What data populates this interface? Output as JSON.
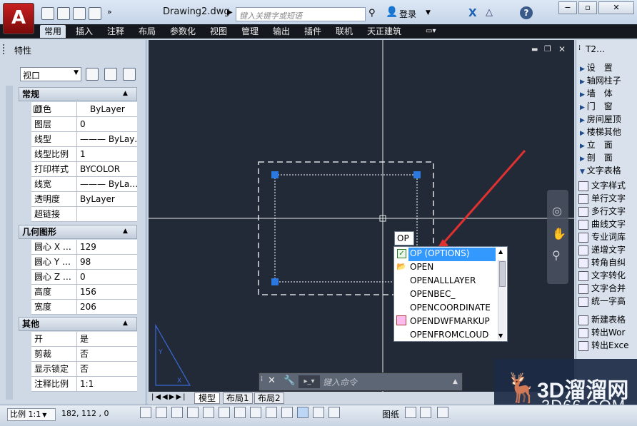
{
  "app": {
    "logo": "A",
    "title": "Drawing2.dwg",
    "search_placeholder": "键入关键字或短语",
    "login": "登录"
  },
  "ribbon_tabs": [
    "常用",
    "插入",
    "注释",
    "布局",
    "参数化",
    "视图",
    "管理",
    "输出",
    "插件",
    "联机",
    "天正建筑"
  ],
  "properties": {
    "title": "特性",
    "selected": "视口",
    "sections": [
      {
        "title": "常规",
        "rows": [
          [
            "颜色",
            "ByLayer"
          ],
          [
            "图层",
            "0"
          ],
          [
            "线型",
            "——— ByLay…"
          ],
          [
            "线型比例",
            "1"
          ],
          [
            "打印样式",
            "BYCOLOR"
          ],
          [
            "线宽",
            "——— ByLa…"
          ],
          [
            "透明度",
            "ByLayer"
          ],
          [
            "超链接",
            ""
          ]
        ]
      },
      {
        "title": "几何图形",
        "rows": [
          [
            "圆心 X …",
            "129"
          ],
          [
            "圆心 Y …",
            "98"
          ],
          [
            "圆心 Z …",
            "0"
          ],
          [
            "高度",
            "156"
          ],
          [
            "宽度",
            "206"
          ]
        ]
      },
      {
        "title": "其他",
        "rows": [
          [
            "开",
            "是"
          ],
          [
            "剪裁",
            "否"
          ],
          [
            "显示锁定",
            "否"
          ],
          [
            "注释比例",
            "1:1"
          ]
        ]
      }
    ]
  },
  "canvas": {
    "typed": "OP",
    "command_placeholder": "键入命令",
    "layout_tabs": [
      "模型",
      "布局1",
      "布局2"
    ]
  },
  "autocomplete": [
    "OP (OPTIONS)",
    "OPEN",
    "OPENALLLAYER",
    "OPENBEC_",
    "OPENCOORDINATE",
    "OPENDWFMARKUP",
    "OPENFROMCLOUD"
  ],
  "tianzheng": {
    "title": "T2…",
    "menu": [
      "设　置",
      "轴网柱子",
      "墙　体",
      "门　窗",
      "房间屋顶",
      "楼梯其他",
      "立　面",
      "剖　面",
      "文字表格"
    ],
    "items": [
      "文字样式",
      "单行文字",
      "多行文字",
      "曲线文字",
      "专业词库",
      "递增文字",
      "转角自纠",
      "文字转化",
      "文字合并",
      "统一字高",
      "新建表格",
      "转出Wor",
      "转出Exce"
    ]
  },
  "status": {
    "scale": "比例 1:1",
    "coords": "182, 112 , 0",
    "paper": "图纸"
  },
  "watermark": {
    "big": "3D溜溜网",
    "small": "3D66.COM"
  },
  "colors": {
    "canvas": "#222a38",
    "accent": "#3399ff",
    "arrow": "#e03030"
  }
}
